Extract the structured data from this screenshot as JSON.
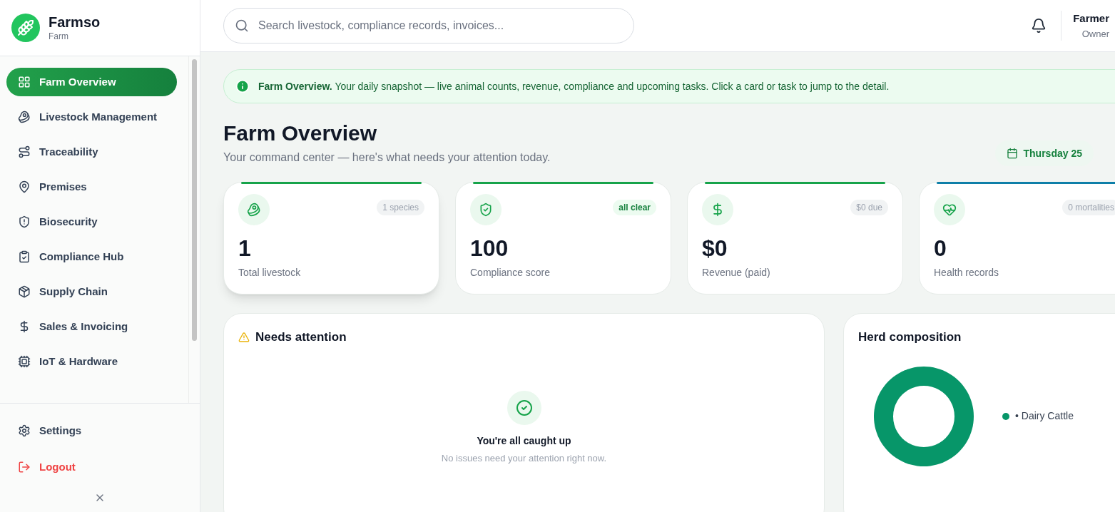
{
  "brand": {
    "name": "Farmso",
    "subtitle": "Farm"
  },
  "sidebar": {
    "items": [
      {
        "label": "Farm Overview",
        "selected": true
      },
      {
        "label": "Livestock Management",
        "selected": false
      },
      {
        "label": "Traceability",
        "selected": false
      },
      {
        "label": "Premises",
        "selected": false
      },
      {
        "label": "Biosecurity",
        "selected": false
      },
      {
        "label": "Compliance Hub",
        "selected": false
      },
      {
        "label": "Supply Chain",
        "selected": false
      },
      {
        "label": "Sales & Invoicing",
        "selected": false
      },
      {
        "label": "IoT & Hardware",
        "selected": false
      }
    ],
    "bottom_items": [
      {
        "label": "Settings",
        "kind": "normal"
      },
      {
        "label": "Logout",
        "kind": "danger"
      }
    ]
  },
  "search": {
    "placeholder": "Search livestock, compliance records, invoices..."
  },
  "user": {
    "name": "Farmer",
    "role": "Owner"
  },
  "banner": {
    "text": "**Farm Overview.** Your daily snapshot — live animal counts, revenue, compliance and upcoming tasks. Click a card or task to jump to the detail."
  },
  "page": {
    "title": "Farm Overview",
    "subtitle": "Your command center — here's what needs your attention today.",
    "date": "Thursday 25"
  },
  "stats": [
    {
      "value": "1",
      "label": "Total livestock",
      "badge": "1 species",
      "badge_highlighted": false,
      "color": "#16a34a"
    },
    {
      "value": "100",
      "label": "Compliance score",
      "badge": "all clear",
      "badge_highlighted": true,
      "color": "#16a34a"
    },
    {
      "value": "$0",
      "label": "Revenue (paid)",
      "badge": "$0 due",
      "badge_highlighted": false,
      "color": "#16a34a"
    },
    {
      "value": "0",
      "label": "Health records",
      "badge": "0 mortalities",
      "badge_highlighted": false,
      "color": "#0e7fa8"
    }
  ],
  "attention": {
    "title": "Needs attention",
    "empty_title": "You're all caught up",
    "empty_text": "No issues need your attention right now."
  },
  "herd": {
    "title": "Herd composition",
    "legend": [
      {
        "label": "• Dairy Cattle",
        "color": "#079669"
      }
    ]
  }
}
